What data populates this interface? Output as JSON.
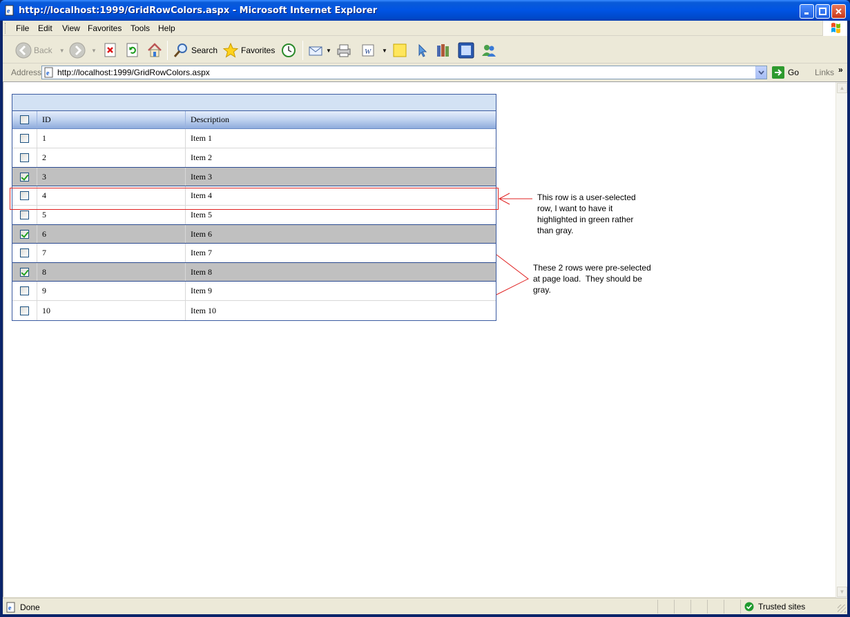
{
  "window": {
    "title": "http://localhost:1999/GridRowColors.aspx - Microsoft Internet Explorer"
  },
  "menu": {
    "items": [
      {
        "label": "File",
        "key": "F"
      },
      {
        "label": "Edit",
        "key": "E"
      },
      {
        "label": "View",
        "key": "V"
      },
      {
        "label": "Favorites",
        "key": "a"
      },
      {
        "label": "Tools",
        "key": "T"
      },
      {
        "label": "Help",
        "key": "H"
      }
    ]
  },
  "toolbar": {
    "back_label": "Back",
    "search_label": "Search",
    "favorites_label": "Favorites"
  },
  "address": {
    "label": "Address",
    "url": "http://localhost:1999/GridRowColors.aspx",
    "go_label": "Go",
    "links_label": "Links"
  },
  "grid": {
    "headers": {
      "id": "ID",
      "description": "Description"
    },
    "rows": [
      {
        "id": "1",
        "description": "Item 1",
        "checked": false
      },
      {
        "id": "2",
        "description": "Item 2",
        "checked": false
      },
      {
        "id": "3",
        "description": "Item 3",
        "checked": true
      },
      {
        "id": "4",
        "description": "Item 4",
        "checked": false
      },
      {
        "id": "5",
        "description": "Item 5",
        "checked": false
      },
      {
        "id": "6",
        "description": "Item 6",
        "checked": true
      },
      {
        "id": "7",
        "description": "Item 7",
        "checked": false
      },
      {
        "id": "8",
        "description": "Item 8",
        "checked": true
      },
      {
        "id": "9",
        "description": "Item 9",
        "checked": false
      },
      {
        "id": "10",
        "description": "Item 10",
        "checked": false
      }
    ],
    "selected_row_color": "#c0c0c0"
  },
  "annotations": {
    "user_selected": [
      "This row is a user-selected",
      "row, I want to have it",
      "highlighted in green rather",
      "than gray."
    ],
    "preselected": [
      "These 2 rows were pre-selected",
      "at page load.  They should be",
      "gray."
    ],
    "color": "#e02020"
  },
  "status": {
    "text": "Done",
    "zone": "Trusted sites"
  }
}
